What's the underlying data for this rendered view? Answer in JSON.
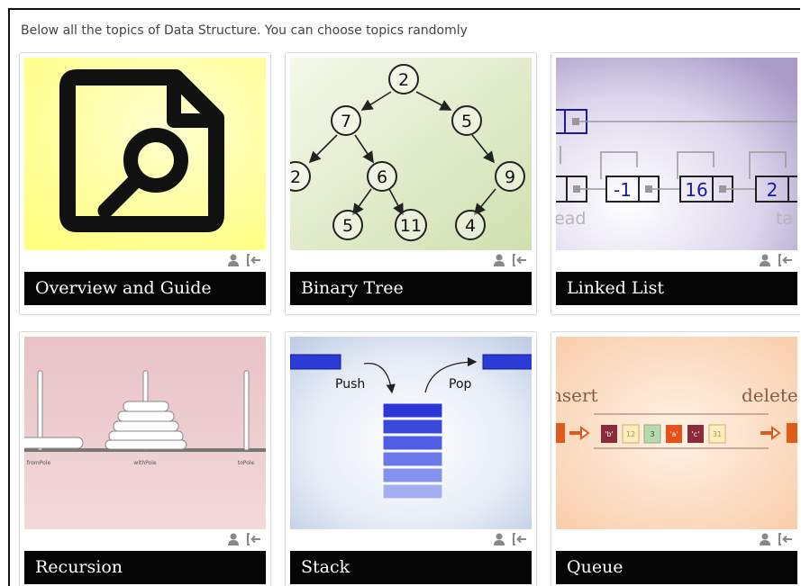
{
  "intro_text": "Below all the topics of Data Structure. You can choose topics randomly",
  "colors": {
    "title_bar": "#050505",
    "meta_icon": "#888888"
  },
  "topics": [
    {
      "title": "Overview and Guide",
      "thumbnail_icon": "document-search-icon"
    },
    {
      "title": "Binary Tree",
      "thumbnail_icon": "binary-tree-icon",
      "image_text": [
        "2",
        "7",
        "5",
        "2",
        "6",
        "9",
        "5",
        "11",
        "4"
      ]
    },
    {
      "title": "Linked List",
      "thumbnail_icon": "linked-list-icon",
      "image_text": [
        "-1",
        "16",
        "2",
        "ead",
        "ta"
      ]
    },
    {
      "title": "Recursion",
      "thumbnail_icon": "tower-of-hanoi-icon",
      "image_text": [
        "fromPole",
        "withPole",
        "toPole"
      ]
    },
    {
      "title": "Stack",
      "thumbnail_icon": "stack-icon",
      "image_text": [
        "Push",
        "Pop"
      ]
    },
    {
      "title": "Queue",
      "thumbnail_icon": "queue-icon",
      "image_text": [
        "nsert",
        "delete",
        "'b'",
        "12",
        "3",
        "'a'",
        "'c'",
        "31"
      ]
    }
  ]
}
